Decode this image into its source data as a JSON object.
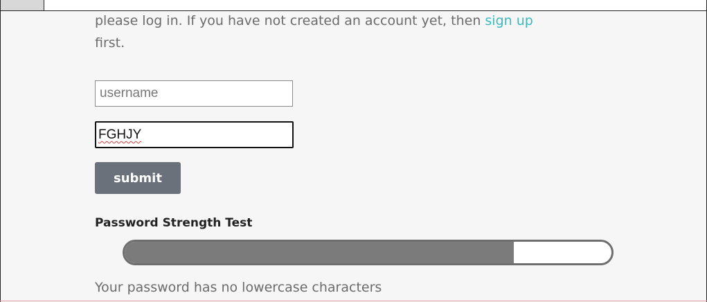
{
  "intro": {
    "text_before_link": "please log in. If you have not created an account yet, then ",
    "signup_link": "sign up",
    "text_after_link": "first."
  },
  "form": {
    "username_placeholder": "username",
    "username_value": "",
    "password_value": "FGHJY",
    "submit_label": "submit"
  },
  "strength": {
    "title": "Password Strength Test",
    "level_fraction": 0.8,
    "message": "Your password has no lowercase characters"
  },
  "colors": {
    "link": "#3cb9bf",
    "button_bg": "#6a717a",
    "meter_fill": "#7b7b7b",
    "spellcheck_underline": "#d43a3a"
  }
}
